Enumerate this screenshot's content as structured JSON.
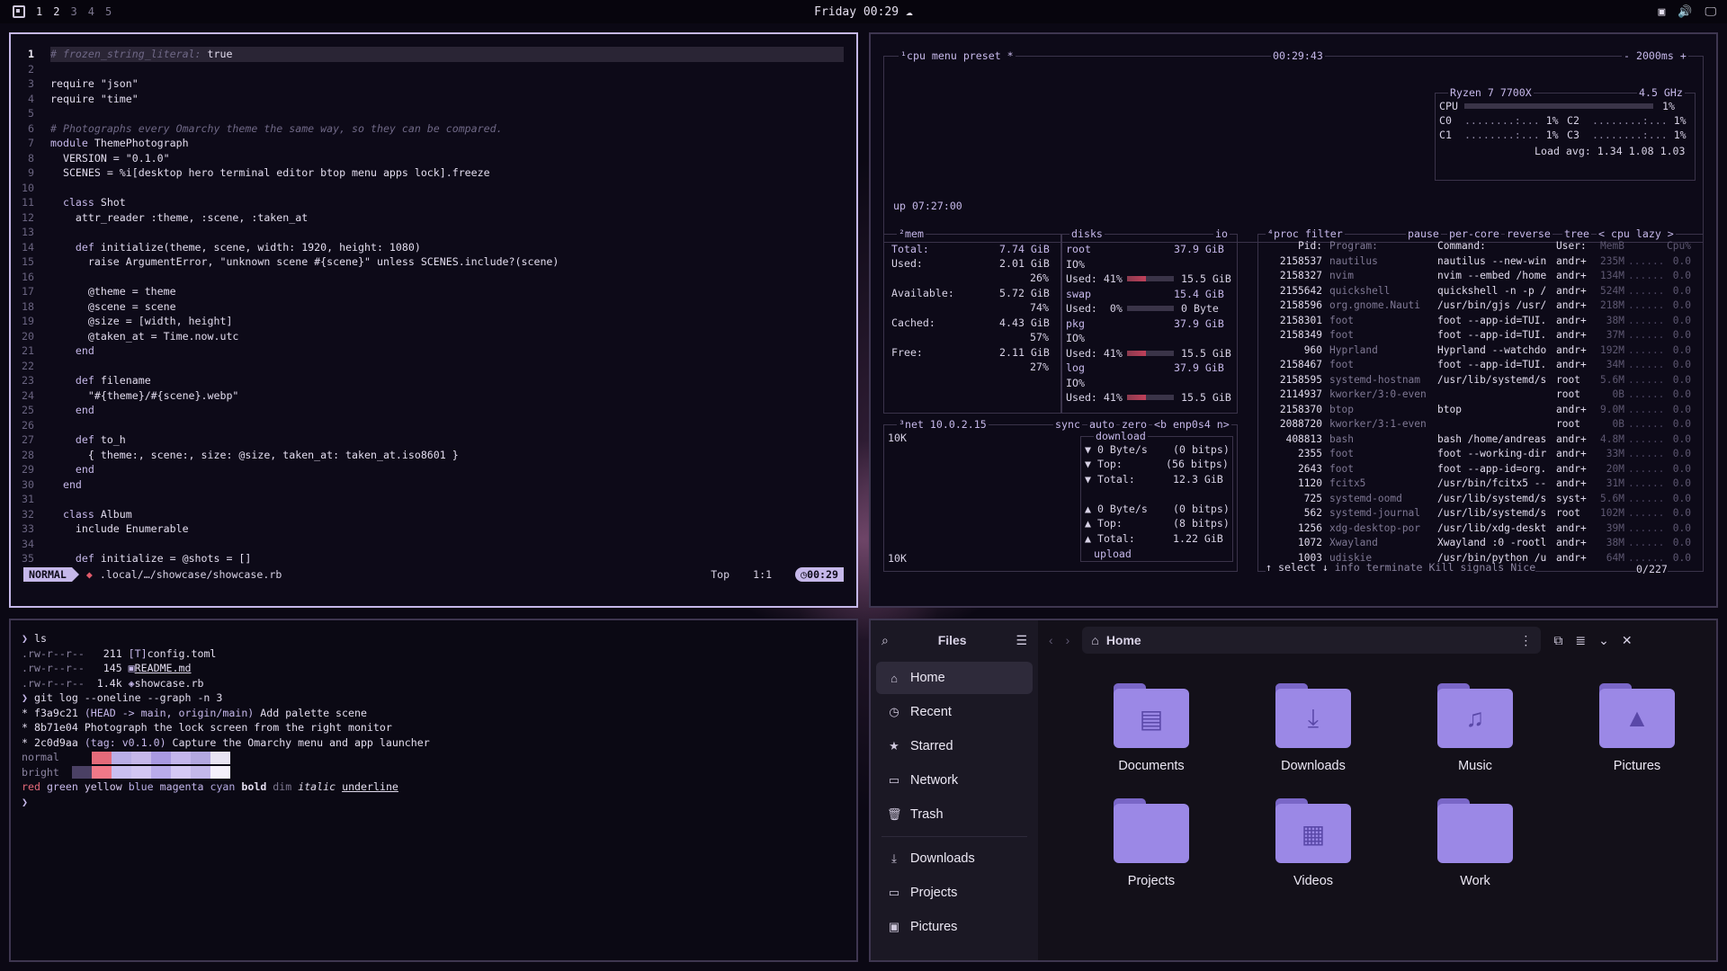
{
  "topbar": {
    "workspaces": [
      "1",
      "2",
      "3",
      "4",
      "5"
    ],
    "active_workspace": "1",
    "clock": "Friday 00:29"
  },
  "nvim": {
    "lines": [
      {
        "n": "1",
        "segments": [
          [
            "cm",
            "# frozen_string_literal: "
          ],
          [
            "str",
            "true"
          ]
        ]
      },
      {
        "n": "2",
        "segments": []
      },
      {
        "n": "3",
        "segments": [
          [
            "str",
            "require \"json\""
          ]
        ]
      },
      {
        "n": "4",
        "segments": [
          [
            "str",
            "require \"time\""
          ]
        ]
      },
      {
        "n": "5",
        "segments": []
      },
      {
        "n": "6",
        "segments": [
          [
            "cm",
            "# Photographs every Omarchy theme the same way, so they can be compared."
          ]
        ]
      },
      {
        "n": "7",
        "segments": [
          [
            "kw",
            "module "
          ],
          [
            "str",
            "ThemePhotograph"
          ]
        ]
      },
      {
        "n": "8",
        "segments": [
          [
            "str",
            "  VERSION = \"0.1.0\""
          ]
        ]
      },
      {
        "n": "9",
        "segments": [
          [
            "str",
            "  SCENES = %i[desktop hero terminal editor btop menu apps lock].freeze"
          ]
        ]
      },
      {
        "n": "10",
        "segments": []
      },
      {
        "n": "11",
        "segments": [
          [
            "kw",
            "  class "
          ],
          [
            "str",
            "Shot"
          ]
        ]
      },
      {
        "n": "12",
        "segments": [
          [
            "str",
            "    attr_reader :theme, :scene, :taken_at"
          ]
        ]
      },
      {
        "n": "13",
        "segments": []
      },
      {
        "n": "14",
        "segments": [
          [
            "kw",
            "    def "
          ],
          [
            "str",
            "initialize(theme, scene, width: 1920, height: 1080)"
          ]
        ]
      },
      {
        "n": "15",
        "segments": [
          [
            "str",
            "      raise ArgumentError, \"unknown scene #{scene}\" unless SCENES.include?(scene)"
          ]
        ]
      },
      {
        "n": "16",
        "segments": []
      },
      {
        "n": "17",
        "segments": [
          [
            "str",
            "      @theme = theme"
          ]
        ]
      },
      {
        "n": "18",
        "segments": [
          [
            "str",
            "      @scene = scene"
          ]
        ]
      },
      {
        "n": "19",
        "segments": [
          [
            "str",
            "      @size = [width, height]"
          ]
        ]
      },
      {
        "n": "20",
        "segments": [
          [
            "str",
            "      @taken_at = Time.now.utc"
          ]
        ]
      },
      {
        "n": "21",
        "segments": [
          [
            "kw",
            "    end"
          ]
        ]
      },
      {
        "n": "22",
        "segments": []
      },
      {
        "n": "23",
        "segments": [
          [
            "kw",
            "    def "
          ],
          [
            "str",
            "filename"
          ]
        ]
      },
      {
        "n": "24",
        "segments": [
          [
            "str",
            "      \"#{theme}/#{scene}.webp\""
          ]
        ]
      },
      {
        "n": "25",
        "segments": [
          [
            "kw",
            "    end"
          ]
        ]
      },
      {
        "n": "26",
        "segments": []
      },
      {
        "n": "27",
        "segments": [
          [
            "kw",
            "    def "
          ],
          [
            "str",
            "to_h"
          ]
        ]
      },
      {
        "n": "28",
        "segments": [
          [
            "str",
            "      { theme:, scene:, size: @size, taken_at: taken_at.iso8601 }"
          ]
        ]
      },
      {
        "n": "29",
        "segments": [
          [
            "kw",
            "    end"
          ]
        ]
      },
      {
        "n": "30",
        "segments": [
          [
            "kw",
            "  end"
          ]
        ]
      },
      {
        "n": "31",
        "segments": []
      },
      {
        "n": "32",
        "segments": [
          [
            "kw",
            "  class "
          ],
          [
            "str",
            "Album"
          ]
        ]
      },
      {
        "n": "33",
        "segments": [
          [
            "str",
            "    include Enumerable"
          ]
        ]
      },
      {
        "n": "34",
        "segments": []
      },
      {
        "n": "35",
        "segments": [
          [
            "kw",
            "    def "
          ],
          [
            "str",
            "initialize = @shots = []"
          ]
        ]
      }
    ],
    "status": {
      "mode": "NORMAL",
      "file": ".local/…/showcase/showcase.rb",
      "position": "Top",
      "cursor": "1:1",
      "time": "00:29"
    }
  },
  "btop": {
    "cpu_box": {
      "title": "¹cpu",
      "menu": "menu",
      "preset": "preset *",
      "clock": "00:29:43",
      "interval": "- 2000ms +",
      "uptime": "up 07:27:00",
      "model": "Ryzen 7 7700X",
      "freq": "4.5 GHz",
      "cpu_total": "1%",
      "cores": [
        {
          "name": "C0",
          "pct": "1%"
        },
        {
          "name": "C1",
          "pct": "1%"
        },
        {
          "name": "C2",
          "pct": "1%"
        },
        {
          "name": "C3",
          "pct": "1%"
        }
      ],
      "load_avg": "Load avg: 1.34 1.08 1.03"
    },
    "mem_box": {
      "title": "²mem",
      "total_label": "Total:",
      "total": "7.74 GiB",
      "used_label": "Used:",
      "used": "2.01 GiB",
      "used_pct": "26%",
      "available_label": "Available:",
      "available": "5.72 GiB",
      "available_pct": "74%",
      "cached_label": "Cached:",
      "cached": "4.43 GiB",
      "cached_pct": "57%",
      "free_label": "Free:",
      "free": "2.11 GiB",
      "free_pct": "27%"
    },
    "disks_box": {
      "title": "disks",
      "io": "io",
      "entries": [
        {
          "name": "root",
          "size": "37.9 GiB",
          "io": "IO%",
          "used": "Used: 41%",
          "used_size": "15.5 GiB"
        },
        {
          "name": "swap",
          "size": "15.4 GiB",
          "io": "",
          "used": "Used:  0%",
          "used_size": "0 Byte"
        },
        {
          "name": "pkg",
          "size": "37.9 GiB",
          "io": "IO%",
          "used": "Used: 41%",
          "used_size": "15.5 GiB"
        },
        {
          "name": "log",
          "size": "37.9 GiB",
          "io": "IO%",
          "used": "Used: 41%",
          "used_size": "15.5 GiB"
        }
      ]
    },
    "net_box": {
      "title": "³net",
      "ip": "10.0.2.15",
      "sync": "sync",
      "auto": "auto",
      "zero": "zero",
      "iface": "<b enp0s4 n>",
      "scale_top": "10K",
      "scale_bottom": "10K",
      "download_label": "download",
      "dl_rate": "▼ 0 Byte/s",
      "dl_rate_bits": "(0 bitps)",
      "dl_top": "▼ Top:",
      "dl_top_bits": "(56 bitps)",
      "dl_total": "▼ Total:",
      "dl_total_val": "12.3 GiB",
      "ul_rate": "▲ 0 Byte/s",
      "ul_rate_bits": "(0 bitps)",
      "ul_top": "▲ Top:",
      "ul_top_bits": "(8 bitps)",
      "ul_total": "▲ Total:",
      "ul_total_val": "1.22 GiB",
      "upload_label": "upload"
    },
    "proc_box": {
      "title": "⁴proc",
      "filter": "filter",
      "pause": "pause",
      "per_core": "per-core",
      "reverse": "reverse",
      "tree": "tree",
      "sort": "< cpu lazy >",
      "headers": {
        "pid": "Pid:",
        "program": "Program:",
        "command": "Command:",
        "user": "User:",
        "mem": "MemB",
        "cpu": "Cpu%"
      },
      "rows": [
        {
          "pid": "2158537",
          "program": "nautilus",
          "command": "nautilus --new-win",
          "user": "andr+",
          "mem": "235M",
          "cpu": "0.0"
        },
        {
          "pid": "2158327",
          "program": "nvim",
          "command": "nvim --embed /home",
          "user": "andr+",
          "mem": "134M",
          "cpu": "0.0"
        },
        {
          "pid": "2155642",
          "program": "quickshell",
          "command": "quickshell -n -p /",
          "user": "andr+",
          "mem": "524M",
          "cpu": "0.0"
        },
        {
          "pid": "2158596",
          "program": "org.gnome.Nauti",
          "command": "/usr/bin/gjs /usr/",
          "user": "andr+",
          "mem": "218M",
          "cpu": "0.0"
        },
        {
          "pid": "2158301",
          "program": "foot",
          "command": "foot --app-id=TUI.",
          "user": "andr+",
          "mem": "38M",
          "cpu": "0.0"
        },
        {
          "pid": "2158349",
          "program": "foot",
          "command": "foot --app-id=TUI.",
          "user": "andr+",
          "mem": "37M",
          "cpu": "0.0"
        },
        {
          "pid": "960",
          "program": "Hyprland",
          "command": "Hyprland --watchdo",
          "user": "andr+",
          "mem": "192M",
          "cpu": "0.0"
        },
        {
          "pid": "2158467",
          "program": "foot",
          "command": "foot --app-id=TUI.",
          "user": "andr+",
          "mem": "34M",
          "cpu": "0.0"
        },
        {
          "pid": "2158595",
          "program": "systemd-hostnam",
          "command": "/usr/lib/systemd/s",
          "user": "root",
          "mem": "5.6M",
          "cpu": "0.0"
        },
        {
          "pid": "2114937",
          "program": "kworker/3:0-even",
          "command": "",
          "user": "root",
          "mem": "0B",
          "cpu": "0.0"
        },
        {
          "pid": "2158370",
          "program": "btop",
          "command": "btop",
          "user": "andr+",
          "mem": "9.0M",
          "cpu": "0.0"
        },
        {
          "pid": "2088720",
          "program": "kworker/3:1-even",
          "command": "",
          "user": "root",
          "mem": "0B",
          "cpu": "0.0"
        },
        {
          "pid": "408813",
          "program": "bash",
          "command": "bash /home/andreas",
          "user": "andr+",
          "mem": "4.8M",
          "cpu": "0.0"
        },
        {
          "pid": "2355",
          "program": "foot",
          "command": "foot --working-dir",
          "user": "andr+",
          "mem": "33M",
          "cpu": "0.0"
        },
        {
          "pid": "2643",
          "program": "foot",
          "command": "foot --app-id=org.",
          "user": "andr+",
          "mem": "20M",
          "cpu": "0.0"
        },
        {
          "pid": "1120",
          "program": "fcitx5",
          "command": "/usr/bin/fcitx5 --",
          "user": "andr+",
          "mem": "31M",
          "cpu": "0.0"
        },
        {
          "pid": "725",
          "program": "systemd-oomd",
          "command": "/usr/lib/systemd/s",
          "user": "syst+",
          "mem": "5.6M",
          "cpu": "0.0"
        },
        {
          "pid": "562",
          "program": "systemd-journal",
          "command": "/usr/lib/systemd/s",
          "user": "root",
          "mem": "102M",
          "cpu": "0.0"
        },
        {
          "pid": "1256",
          "program": "xdg-desktop-por",
          "command": "/usr/lib/xdg-deskt",
          "user": "andr+",
          "mem": "39M",
          "cpu": "0.0"
        },
        {
          "pid": "1072",
          "program": "Xwayland",
          "command": "Xwayland :0 -rootl",
          "user": "andr+",
          "mem": "38M",
          "cpu": "0.0"
        },
        {
          "pid": "1003",
          "program": "udiskie",
          "command": "/usr/bin/python /u",
          "user": "andr+",
          "mem": "64M",
          "cpu": "0.0"
        }
      ],
      "footer": {
        "select": "↑ select ↓",
        "info": "info",
        "terminate": "terminate",
        "kill": "Kill",
        "signals": "signals",
        "nice": "Nice",
        "count": "0/227"
      }
    }
  },
  "terminal": {
    "lines": [
      {
        "kind": "prompt",
        "text": "ls"
      },
      {
        "kind": "file",
        "perm": ".rw-r--r--",
        "size": "211",
        "icon": "[T]",
        "name": "config.toml"
      },
      {
        "kind": "file",
        "perm": ".rw-r--r--",
        "size": "145",
        "icon": "▣",
        "name": "README.md"
      },
      {
        "kind": "file",
        "perm": ".rw-r--r--",
        "size": "1.4k",
        "icon": "◈",
        "name": "showcase.rb"
      },
      {
        "kind": "prompt",
        "text": "git log --oneline --graph -n 3"
      },
      {
        "kind": "commit",
        "hash": "f3a9c21",
        "ref": "(HEAD -> main, origin/main)",
        "msg": "Add palette scene"
      },
      {
        "kind": "commit",
        "hash": "8b71e04",
        "ref": "",
        "msg": "Photograph the lock screen from the right monitor"
      },
      {
        "kind": "commit",
        "hash": "2c0d9aa",
        "ref": "(tag: v0.1.0)",
        "msg": "Capture the Omarchy menu and app launcher"
      }
    ],
    "palette_normal_label": "normal",
    "palette_bright_label": "bright",
    "palette_normal": [
      "#0b0914",
      "#e46a7a",
      "#b9aee6",
      "#c6b8ea",
      "#a99ae2",
      "#c4b6ec",
      "#b3a8e0",
      "#e8e4f2"
    ],
    "palette_bright": [
      "#4a4064",
      "#f07888",
      "#c9bff0",
      "#d2c6f2",
      "#b9acea",
      "#d4c8f4",
      "#c3b8ea",
      "#f4f0fa"
    ],
    "styles": [
      "red",
      "green",
      "yellow",
      "blue",
      "magenta",
      "cyan",
      "bold",
      "dim",
      "italic",
      "underline"
    ]
  },
  "files": {
    "title": "Files",
    "path": "Home",
    "sidebar": [
      {
        "label": "Home",
        "icon": "home-icon",
        "active": true
      },
      {
        "label": "Recent",
        "icon": "clock-icon"
      },
      {
        "label": "Starred",
        "icon": "star-icon"
      },
      {
        "label": "Network",
        "icon": "network-icon"
      },
      {
        "label": "Trash",
        "icon": "trash-icon"
      }
    ],
    "bookmarks": [
      {
        "label": "Downloads",
        "icon": "download-icon"
      },
      {
        "label": "Projects",
        "icon": "folder-icon"
      },
      {
        "label": "Pictures",
        "icon": "image-icon"
      }
    ],
    "folders": [
      {
        "label": "Documents",
        "glyph": "▤"
      },
      {
        "label": "Downloads",
        "glyph": "⤓"
      },
      {
        "label": "Music",
        "glyph": "♫"
      },
      {
        "label": "Pictures",
        "glyph": "▲"
      },
      {
        "label": "Projects",
        "glyph": ""
      },
      {
        "label": "Videos",
        "glyph": "▦"
      },
      {
        "label": "Work",
        "glyph": ""
      }
    ]
  }
}
